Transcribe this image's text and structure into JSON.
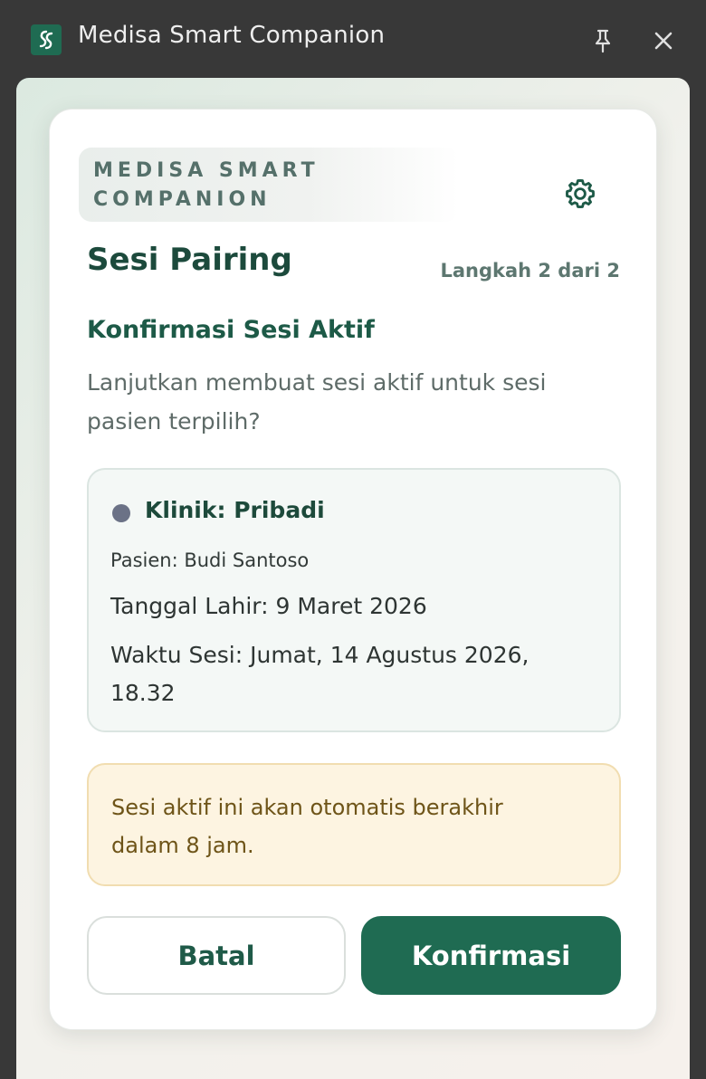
{
  "window": {
    "title": "Medisa Smart Companion",
    "logo_icon": "medisa-logo-icon",
    "pin_icon": "pin-icon",
    "close_icon": "close-icon"
  },
  "card": {
    "brand": "MEDISA SMART COMPANION",
    "settings_icon": "gear-icon",
    "title": "Sesi Pairing",
    "step": "Langkah 2 dari 2",
    "section_title": "Konfirmasi Sesi Aktif",
    "section_desc": "Lanjutkan membuat sesi aktif untuk sesi pasien terpilih?"
  },
  "session": {
    "clinic": "Klinik: Pribadi",
    "patient": "Pasien: Budi Santoso",
    "birth_date": "Tanggal Lahir: 9 Maret 2026",
    "session_time": "Waktu Sesi: Jumat, 14 Agustus 2026, 18.32"
  },
  "warning": {
    "text": "Sesi aktif ini akan otomatis berakhir dalam 8 jam."
  },
  "actions": {
    "cancel_label": "Batal",
    "confirm_label": "Konfirmasi"
  },
  "colors": {
    "accent": "#1f6b52",
    "title_text": "#1c4a3c",
    "warning_bg": "#fdf4e1",
    "warning_text": "#6e5418",
    "clinic_dot": "#6b7286"
  }
}
